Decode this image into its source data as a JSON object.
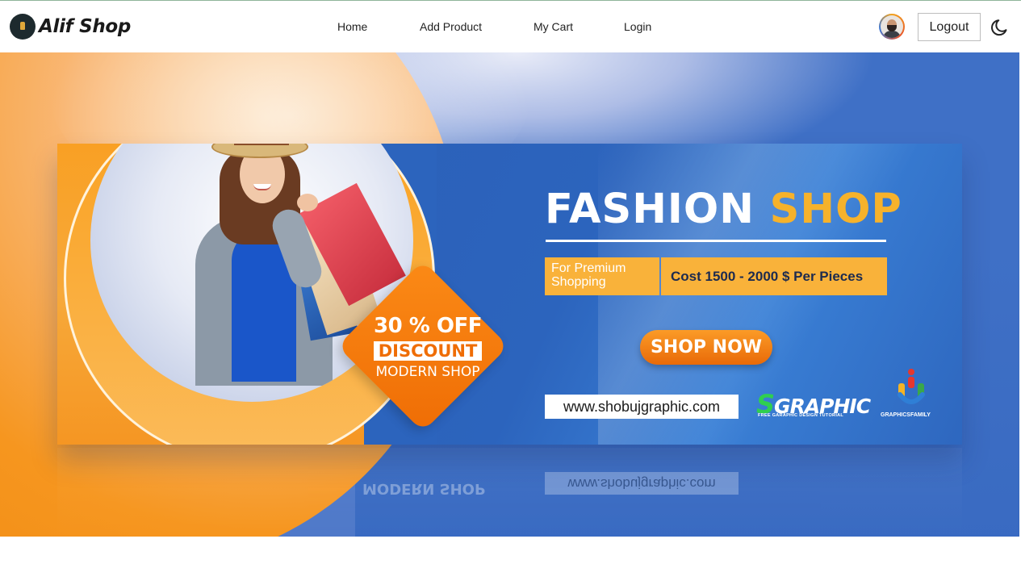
{
  "app": {
    "brand": "Alif Shop"
  },
  "nav": {
    "links": [
      {
        "label": "Home"
      },
      {
        "label": "Add Product"
      },
      {
        "label": "My Cart"
      },
      {
        "label": "Login"
      }
    ],
    "logout_label": "Logout",
    "icons": {
      "avatar": "user-avatar",
      "theme": "moon-icon"
    }
  },
  "banner": {
    "headline_main": "FASHION",
    "headline_accent": "SHOP",
    "premium_line1": "For Premium",
    "premium_line2": "Shopping",
    "cost_text": "Cost 1500 - 2000 $ Per Pieces",
    "discount_line1": "30 % OFF",
    "discount_line2": "DISCOUNT",
    "discount_line3": "MODERN SHOP",
    "cta_label": "SHOP NOW",
    "website": "www.shobujgraphic.com",
    "logo1_big": "GRAPHIC",
    "logo1_letter": "S",
    "logo1_small": "FREE GARAPHIC DESIGN TUTORIAL",
    "logo2_text": "GRAPHICSFAMILY",
    "colors": {
      "orange": "#f6961f",
      "blue": "#2c64bd",
      "yellow": "#f6b22b"
    }
  }
}
